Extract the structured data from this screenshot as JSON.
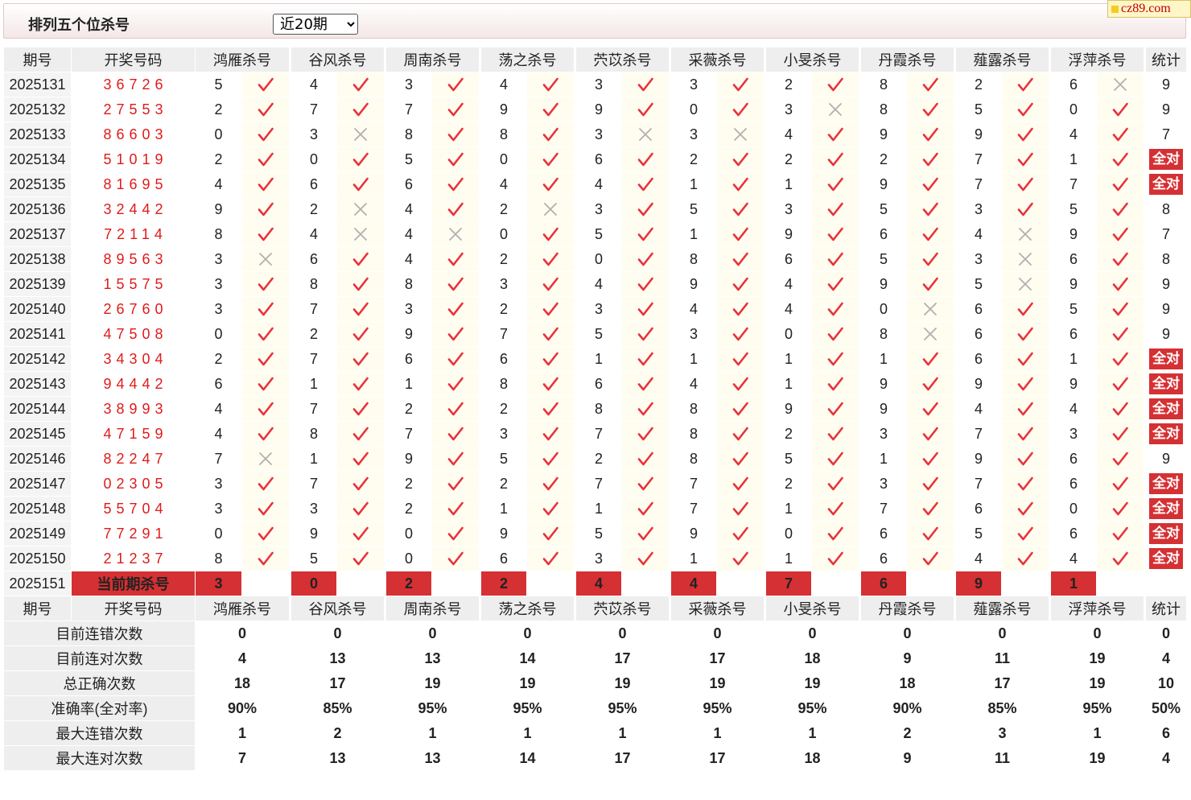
{
  "header": {
    "title": "排列五个位杀号",
    "select_value": "近20期",
    "logo_text": "cz89.com"
  },
  "colors": {
    "accent": "#d53033",
    "check": "#e8323c",
    "cross": "#b0b0b0",
    "stat_blue": "#1a1ac8",
    "draw_red": "#e01a1a"
  },
  "columns": {
    "period": "期号",
    "number": "开奖号码",
    "experts": [
      "鸿雁杀号",
      "谷风杀号",
      "周南杀号",
      "荡之杀号",
      "茓苡杀号",
      "采薇杀号",
      "小旻杀号",
      "丹霞杀号",
      "薤露杀号",
      "浮萍杀号"
    ],
    "total": "统计"
  },
  "all_correct_label": "全对",
  "rows": [
    {
      "period": "2025131",
      "number": "36726",
      "kills": [
        [
          5,
          1
        ],
        [
          4,
          1
        ],
        [
          3,
          1
        ],
        [
          4,
          1
        ],
        [
          3,
          1
        ],
        [
          3,
          1
        ],
        [
          2,
          1
        ],
        [
          8,
          1
        ],
        [
          2,
          1
        ],
        [
          6,
          0
        ]
      ],
      "total": "9"
    },
    {
      "period": "2025132",
      "number": "27553",
      "kills": [
        [
          2,
          1
        ],
        [
          7,
          1
        ],
        [
          7,
          1
        ],
        [
          9,
          1
        ],
        [
          9,
          1
        ],
        [
          0,
          1
        ],
        [
          3,
          0
        ],
        [
          8,
          1
        ],
        [
          5,
          1
        ],
        [
          0,
          1
        ]
      ],
      "total": "9"
    },
    {
      "period": "2025133",
      "number": "86603",
      "kills": [
        [
          0,
          1
        ],
        [
          3,
          0
        ],
        [
          8,
          1
        ],
        [
          8,
          1
        ],
        [
          3,
          0
        ],
        [
          3,
          0
        ],
        [
          4,
          1
        ],
        [
          9,
          1
        ],
        [
          9,
          1
        ],
        [
          4,
          1
        ]
      ],
      "total": "7"
    },
    {
      "period": "2025134",
      "number": "51019",
      "kills": [
        [
          2,
          1
        ],
        [
          0,
          1
        ],
        [
          5,
          1
        ],
        [
          0,
          1
        ],
        [
          6,
          1
        ],
        [
          2,
          1
        ],
        [
          2,
          1
        ],
        [
          2,
          1
        ],
        [
          7,
          1
        ],
        [
          1,
          1
        ]
      ],
      "total": "全对"
    },
    {
      "period": "2025135",
      "number": "81695",
      "kills": [
        [
          4,
          1
        ],
        [
          6,
          1
        ],
        [
          6,
          1
        ],
        [
          4,
          1
        ],
        [
          4,
          1
        ],
        [
          1,
          1
        ],
        [
          1,
          1
        ],
        [
          9,
          1
        ],
        [
          7,
          1
        ],
        [
          7,
          1
        ]
      ],
      "total": "全对"
    },
    {
      "period": "2025136",
      "number": "32442",
      "kills": [
        [
          9,
          1
        ],
        [
          2,
          0
        ],
        [
          4,
          1
        ],
        [
          2,
          0
        ],
        [
          3,
          1
        ],
        [
          5,
          1
        ],
        [
          3,
          1
        ],
        [
          5,
          1
        ],
        [
          3,
          1
        ],
        [
          5,
          1
        ]
      ],
      "total": "8"
    },
    {
      "period": "2025137",
      "number": "72114",
      "kills": [
        [
          8,
          1
        ],
        [
          4,
          0
        ],
        [
          4,
          0
        ],
        [
          0,
          1
        ],
        [
          5,
          1
        ],
        [
          1,
          1
        ],
        [
          9,
          1
        ],
        [
          6,
          1
        ],
        [
          4,
          0
        ],
        [
          9,
          1
        ]
      ],
      "total": "7"
    },
    {
      "period": "2025138",
      "number": "89563",
      "kills": [
        [
          3,
          0
        ],
        [
          6,
          1
        ],
        [
          4,
          1
        ],
        [
          2,
          1
        ],
        [
          0,
          1
        ],
        [
          8,
          1
        ],
        [
          6,
          1
        ],
        [
          5,
          1
        ],
        [
          3,
          0
        ],
        [
          6,
          1
        ]
      ],
      "total": "8"
    },
    {
      "period": "2025139",
      "number": "15575",
      "kills": [
        [
          3,
          1
        ],
        [
          8,
          1
        ],
        [
          8,
          1
        ],
        [
          3,
          1
        ],
        [
          4,
          1
        ],
        [
          9,
          1
        ],
        [
          4,
          1
        ],
        [
          9,
          1
        ],
        [
          5,
          0
        ],
        [
          9,
          1
        ]
      ],
      "total": "9"
    },
    {
      "period": "2025140",
      "number": "26760",
      "kills": [
        [
          3,
          1
        ],
        [
          7,
          1
        ],
        [
          3,
          1
        ],
        [
          2,
          1
        ],
        [
          3,
          1
        ],
        [
          4,
          1
        ],
        [
          4,
          1
        ],
        [
          0,
          0
        ],
        [
          6,
          1
        ],
        [
          5,
          1
        ]
      ],
      "total": "9"
    },
    {
      "period": "2025141",
      "number": "47508",
      "kills": [
        [
          0,
          1
        ],
        [
          2,
          1
        ],
        [
          9,
          1
        ],
        [
          7,
          1
        ],
        [
          5,
          1
        ],
        [
          3,
          1
        ],
        [
          0,
          1
        ],
        [
          8,
          0
        ],
        [
          6,
          1
        ],
        [
          6,
          1
        ]
      ],
      "total": "9"
    },
    {
      "period": "2025142",
      "number": "34304",
      "kills": [
        [
          2,
          1
        ],
        [
          7,
          1
        ],
        [
          6,
          1
        ],
        [
          6,
          1
        ],
        [
          1,
          1
        ],
        [
          1,
          1
        ],
        [
          1,
          1
        ],
        [
          1,
          1
        ],
        [
          6,
          1
        ],
        [
          1,
          1
        ]
      ],
      "total": "全对"
    },
    {
      "period": "2025143",
      "number": "94442",
      "kills": [
        [
          6,
          1
        ],
        [
          1,
          1
        ],
        [
          1,
          1
        ],
        [
          8,
          1
        ],
        [
          6,
          1
        ],
        [
          4,
          1
        ],
        [
          1,
          1
        ],
        [
          9,
          1
        ],
        [
          9,
          1
        ],
        [
          9,
          1
        ]
      ],
      "total": "全对"
    },
    {
      "period": "2025144",
      "number": "38993",
      "kills": [
        [
          4,
          1
        ],
        [
          7,
          1
        ],
        [
          2,
          1
        ],
        [
          2,
          1
        ],
        [
          8,
          1
        ],
        [
          8,
          1
        ],
        [
          9,
          1
        ],
        [
          9,
          1
        ],
        [
          4,
          1
        ],
        [
          4,
          1
        ]
      ],
      "total": "全对"
    },
    {
      "period": "2025145",
      "number": "47159",
      "kills": [
        [
          4,
          1
        ],
        [
          8,
          1
        ],
        [
          7,
          1
        ],
        [
          3,
          1
        ],
        [
          7,
          1
        ],
        [
          8,
          1
        ],
        [
          2,
          1
        ],
        [
          3,
          1
        ],
        [
          7,
          1
        ],
        [
          3,
          1
        ]
      ],
      "total": "全对"
    },
    {
      "period": "2025146",
      "number": "82247",
      "kills": [
        [
          7,
          0
        ],
        [
          1,
          1
        ],
        [
          9,
          1
        ],
        [
          5,
          1
        ],
        [
          2,
          1
        ],
        [
          8,
          1
        ],
        [
          5,
          1
        ],
        [
          1,
          1
        ],
        [
          9,
          1
        ],
        [
          6,
          1
        ]
      ],
      "total": "9"
    },
    {
      "period": "2025147",
      "number": "02305",
      "kills": [
        [
          3,
          1
        ],
        [
          7,
          1
        ],
        [
          2,
          1
        ],
        [
          2,
          1
        ],
        [
          7,
          1
        ],
        [
          7,
          1
        ],
        [
          2,
          1
        ],
        [
          3,
          1
        ],
        [
          7,
          1
        ],
        [
          6,
          1
        ]
      ],
      "total": "全对"
    },
    {
      "period": "2025148",
      "number": "55704",
      "kills": [
        [
          3,
          1
        ],
        [
          3,
          1
        ],
        [
          2,
          1
        ],
        [
          1,
          1
        ],
        [
          1,
          1
        ],
        [
          7,
          1
        ],
        [
          1,
          1
        ],
        [
          7,
          1
        ],
        [
          6,
          1
        ],
        [
          0,
          1
        ]
      ],
      "total": "全对"
    },
    {
      "period": "2025149",
      "number": "77291",
      "kills": [
        [
          0,
          1
        ],
        [
          9,
          1
        ],
        [
          0,
          1
        ],
        [
          9,
          1
        ],
        [
          5,
          1
        ],
        [
          9,
          1
        ],
        [
          0,
          1
        ],
        [
          6,
          1
        ],
        [
          5,
          1
        ],
        [
          6,
          1
        ]
      ],
      "total": "全对"
    },
    {
      "period": "2025150",
      "number": "21237",
      "kills": [
        [
          8,
          1
        ],
        [
          5,
          1
        ],
        [
          0,
          1
        ],
        [
          6,
          1
        ],
        [
          3,
          1
        ],
        [
          1,
          1
        ],
        [
          1,
          1
        ],
        [
          6,
          1
        ],
        [
          4,
          1
        ],
        [
          4,
          1
        ]
      ],
      "total": "全对"
    }
  ],
  "current": {
    "period": "2025151",
    "label": "当前期杀号",
    "kills": [
      "3",
      "0",
      "2",
      "2",
      "4",
      "4",
      "7",
      "6",
      "9",
      "1"
    ]
  },
  "stats": [
    {
      "label": "目前连错次数",
      "values": [
        "0",
        "0",
        "0",
        "0",
        "0",
        "0",
        "0",
        "0",
        "0",
        "0"
      ],
      "total": "0",
      "rate": false
    },
    {
      "label": "目前连对次数",
      "values": [
        "4",
        "13",
        "13",
        "14",
        "17",
        "17",
        "18",
        "9",
        "11",
        "19"
      ],
      "total": "4",
      "rate": false
    },
    {
      "label": "总正确次数",
      "values": [
        "18",
        "17",
        "19",
        "19",
        "19",
        "19",
        "19",
        "18",
        "17",
        "19"
      ],
      "total": "10",
      "rate": false
    },
    {
      "label": "准确率(全对率)",
      "values": [
        "90%",
        "85%",
        "95%",
        "95%",
        "95%",
        "95%",
        "95%",
        "90%",
        "85%",
        "95%"
      ],
      "total": "50%",
      "rate": true
    },
    {
      "label": "最大连错次数",
      "values": [
        "1",
        "2",
        "1",
        "1",
        "1",
        "1",
        "1",
        "2",
        "3",
        "1"
      ],
      "total": "6",
      "rate": false
    },
    {
      "label": "最大连对次数",
      "values": [
        "7",
        "13",
        "13",
        "14",
        "17",
        "17",
        "18",
        "9",
        "11",
        "19"
      ],
      "total": "4",
      "rate": false
    }
  ]
}
